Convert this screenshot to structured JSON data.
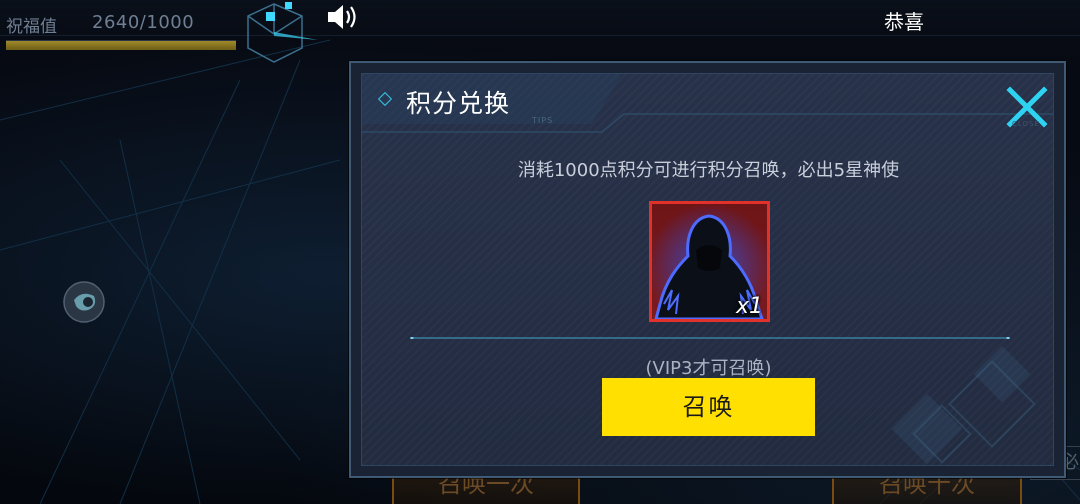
{
  "hud": {
    "blessing_label": "祝福值",
    "blessing_value": "2640/1000",
    "blessing_progress": 1.0,
    "congrats_text": "恭喜"
  },
  "background_buttons": {
    "summon_once": "召唤一次",
    "summon_ten": "召唤十次",
    "extra": "必"
  },
  "modal": {
    "title": "积分兑换",
    "tips_tag": "TIPS",
    "close_tag": "CLOSE",
    "description": "消耗1000点积分可进行积分召唤，必出5星神使",
    "reward": {
      "count": "x1",
      "frame_color": "#e0322b"
    },
    "vip_note": "(VIP3才可召唤)",
    "summon_button": "召唤"
  },
  "colors": {
    "accent_cyan": "#35c8e8",
    "button_yellow": "#ffe000"
  },
  "icons": [
    "cube-icon",
    "speaker-icon",
    "orb-icon",
    "close-icon",
    "title-diamond-icon"
  ]
}
